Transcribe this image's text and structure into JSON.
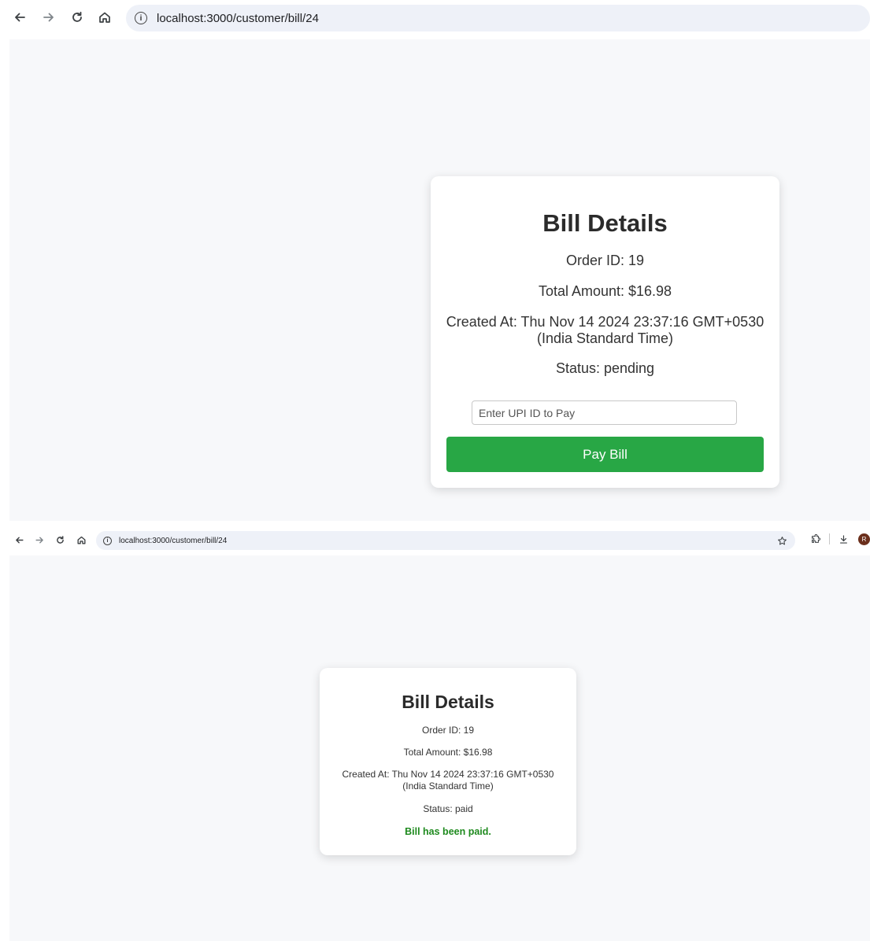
{
  "screens": [
    {
      "browser": {
        "url": "localhost:3000/customer/bill/24"
      },
      "bill": {
        "title": "Bill Details",
        "order_id": "Order ID: 19",
        "total_amount": "Total Amount: $16.98",
        "created_at_line1": "Created At: Thu Nov 14 2024 23:37:16 GMT+0530",
        "created_at_line2": "(India Standard Time)",
        "status": "Status: pending",
        "upi_placeholder": "Enter UPI ID to Pay",
        "pay_button": "Pay Bill"
      }
    },
    {
      "browser": {
        "url": "localhost:3000/customer/bill/24",
        "avatar_letter": "R"
      },
      "bill": {
        "title": "Bill Details",
        "order_id": "Order ID: 19",
        "total_amount": "Total Amount: $16.98",
        "created_at_line1": "Created At: Thu Nov 14 2024 23:37:16 GMT+0530",
        "created_at_line2": "(India Standard Time)",
        "status": "Status: paid",
        "paid_message": "Bill has been paid."
      }
    }
  ],
  "colors": {
    "pay_button": "#28a745",
    "paid_message": "#1e8a1e",
    "page_background": "#f7f8fa"
  }
}
